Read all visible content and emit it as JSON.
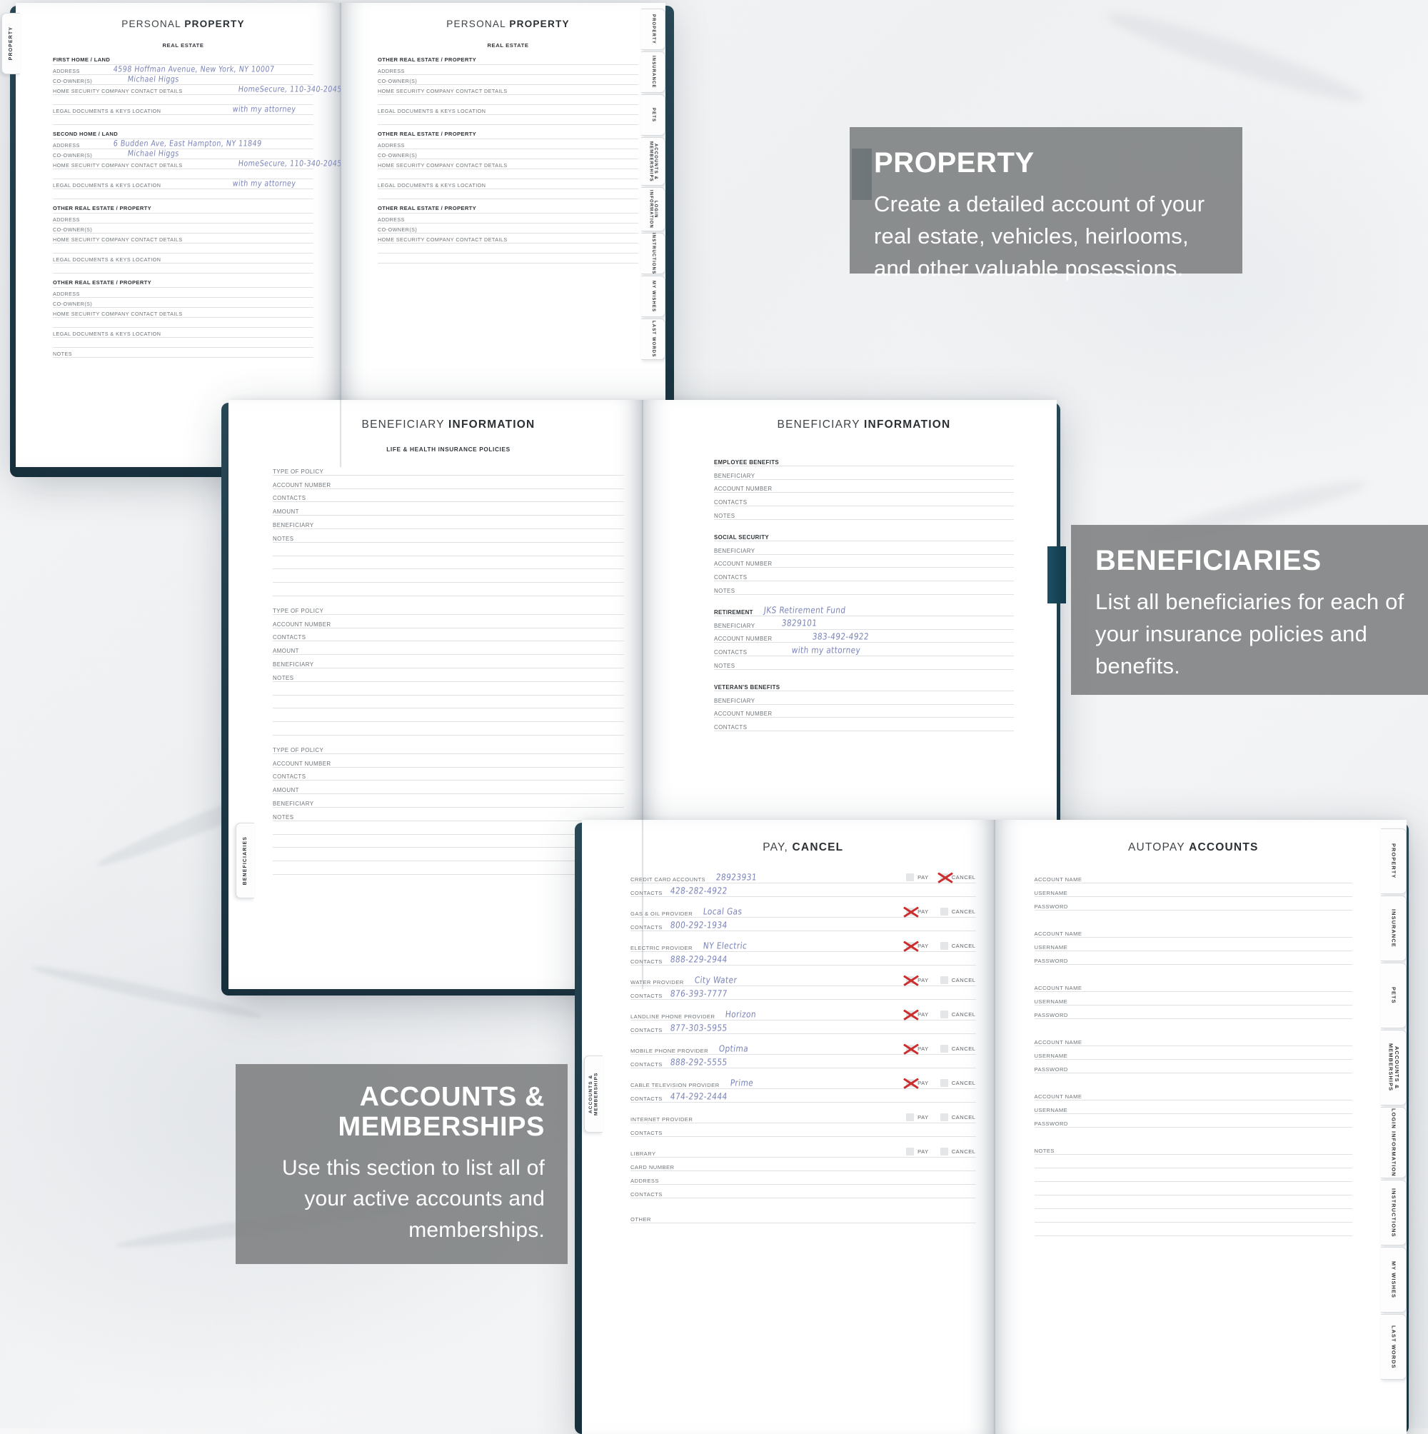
{
  "theme": {
    "accent": "#1e3c4a",
    "caption_bg": "rgba(124,126,128,0.88)",
    "handwriting": "#7b84b8",
    "x_mark": "#cc2f2f"
  },
  "captions": [
    {
      "title": "PROPERTY",
      "text": "Create a detailed account of your real estate, vehicles, heirlooms, and other valuable posessions."
    },
    {
      "title": "BENEFICIARIES",
      "text": "List all beneficiaries for each of your insurance policies and benefits."
    },
    {
      "title": "ACCOUNTS & MEMBERSHIPS",
      "text": "Use this section to list all of your active accounts and memberships."
    }
  ],
  "index_tabs": [
    "PROPERTY",
    "INSURANCE",
    "PETS",
    "ACCOUNTS & MEMBERSHIPS",
    "LOGIN INFORMATION",
    "INSTRUCTIONS",
    "MY WISHES",
    "LAST WORDS"
  ],
  "left_tabs": {
    "book1": "PROPERTY",
    "book2": "BENEFICIARIES",
    "book3": "ACCOUNTS & MEMBERSHIPS"
  },
  "book1": {
    "left_page": {
      "title_light": "PERSONAL ",
      "title_bold": "PROPERTY",
      "section": "REAL ESTATE",
      "groups": [
        {
          "heading": "FIRST HOME / LAND",
          "fields": [
            {
              "label": "ADDRESS",
              "value": "4598 Hoffman Avenue, New York, NY 10007",
              "indent": 74
            },
            {
              "label": "CO-OWNER(S)",
              "value": "Michael Higgs",
              "indent": 92
            },
            {
              "label": "HOME SECURITY COMPANY CONTACT DETAILS",
              "value": "HomeSecure, 110-340-2045",
              "indent": 224
            },
            {
              "label": "",
              "value": ""
            },
            {
              "label": "LEGAL DOCUMENTS & KEYS LOCATION",
              "value": "with my attorney",
              "indent": 222
            },
            {
              "label": "",
              "value": ""
            }
          ]
        },
        {
          "heading": "SECOND HOME / LAND",
          "fields": [
            {
              "label": "ADDRESS",
              "value": "6 Budden Ave, East  Hampton, NY 11849",
              "indent": 74
            },
            {
              "label": "CO-OWNER(S)",
              "value": "Michael Higgs",
              "indent": 92
            },
            {
              "label": "HOME SECURITY COMPANY CONTACT DETAILS",
              "value": "HomeSecure, 110-340-2045",
              "indent": 224
            },
            {
              "label": "",
              "value": ""
            },
            {
              "label": "LEGAL DOCUMENTS & KEYS LOCATION",
              "value": "with my attorney",
              "indent": 222
            },
            {
              "label": "",
              "value": ""
            }
          ]
        },
        {
          "heading": "OTHER REAL ESTATE / PROPERTY",
          "fields": [
            {
              "label": "ADDRESS",
              "value": ""
            },
            {
              "label": "CO-OWNER(S)",
              "value": ""
            },
            {
              "label": "HOME SECURITY COMPANY CONTACT DETAILS",
              "value": ""
            },
            {
              "label": "",
              "value": ""
            },
            {
              "label": "LEGAL DOCUMENTS & KEYS LOCATION",
              "value": ""
            },
            {
              "label": "",
              "value": ""
            }
          ]
        },
        {
          "heading": "OTHER REAL ESTATE / PROPERTY",
          "fields": [
            {
              "label": "ADDRESS",
              "value": ""
            },
            {
              "label": "CO-OWNER(S)",
              "value": ""
            },
            {
              "label": "HOME SECURITY COMPANY CONTACT DETAILS",
              "value": ""
            },
            {
              "label": "",
              "value": ""
            },
            {
              "label": "LEGAL DOCUMENTS & KEYS LOCATION",
              "value": ""
            },
            {
              "label": "",
              "value": ""
            },
            {
              "label": "NOTES",
              "value": ""
            }
          ]
        }
      ]
    },
    "right_page": {
      "title_light": "PERSONAL ",
      "title_bold": "PROPERTY",
      "section": "REAL ESTATE",
      "groups": [
        {
          "heading": "OTHER REAL ESTATE / PROPERTY",
          "fields": [
            {
              "label": "ADDRESS",
              "value": ""
            },
            {
              "label": "CO-OWNER(S)",
              "value": ""
            },
            {
              "label": "HOME SECURITY COMPANY CONTACT DETAILS",
              "value": ""
            },
            {
              "label": "",
              "value": ""
            },
            {
              "label": "LEGAL DOCUMENTS & KEYS LOCATION",
              "value": ""
            },
            {
              "label": "",
              "value": ""
            }
          ]
        },
        {
          "heading": "OTHER REAL ESTATE / PROPERTY",
          "fields": [
            {
              "label": "ADDRESS",
              "value": ""
            },
            {
              "label": "CO-OWNER(S)",
              "value": ""
            },
            {
              "label": "HOME SECURITY COMPANY CONTACT DETAILS",
              "value": ""
            },
            {
              "label": "",
              "value": ""
            },
            {
              "label": "LEGAL DOCUMENTS & KEYS LOCATION",
              "value": ""
            },
            {
              "label": "",
              "value": ""
            }
          ]
        },
        {
          "heading": "OTHER REAL ESTATE / PROPERTY",
          "fields": [
            {
              "label": "ADDRESS",
              "value": ""
            },
            {
              "label": "CO-OWNER(S)",
              "value": ""
            },
            {
              "label": "HOME SECURITY COMPANY CONTACT DETAILS",
              "value": ""
            },
            {
              "label": "",
              "value": ""
            },
            {
              "label": "",
              "value": ""
            }
          ]
        }
      ]
    }
  },
  "book2": {
    "left_page": {
      "title_light": "BENEFICIARY ",
      "title_bold": "INFORMATION",
      "section": "LIFE & HEALTH INSURANCE POLICIES",
      "blocks": [
        {
          "rows": [
            "TYPE OF POLICY",
            "ACCOUNT NUMBER",
            "CONTACTS",
            "AMOUNT",
            "BENEFICIARY",
            "NOTES"
          ],
          "extra": 4
        },
        {
          "rows": [
            "TYPE OF POLICY",
            "ACCOUNT NUMBER",
            "CONTACTS",
            "AMOUNT",
            "BENEFICIARY",
            "NOTES"
          ],
          "extra": 4
        },
        {
          "rows": [
            "TYPE OF POLICY",
            "ACCOUNT NUMBER",
            "CONTACTS",
            "AMOUNT",
            "BENEFICIARY",
            "NOTES"
          ],
          "extra": 4
        }
      ]
    },
    "right_page": {
      "title_light": "BENEFICIARY ",
      "title_bold": "INFORMATION",
      "groups": [
        {
          "heading": "EMPLOYEE BENEFITS",
          "heading_value": "",
          "fields": [
            {
              "label": "BENEFICIARY",
              "value": ""
            },
            {
              "label": "ACCOUNT NUMBER",
              "value": ""
            },
            {
              "label": "CONTACTS",
              "value": ""
            },
            {
              "label": "NOTES",
              "value": ""
            }
          ]
        },
        {
          "heading": "SOCIAL SECURITY",
          "heading_value": "",
          "fields": [
            {
              "label": "BENEFICIARY",
              "value": ""
            },
            {
              "label": "ACCOUNT NUMBER",
              "value": ""
            },
            {
              "label": "CONTACTS",
              "value": ""
            },
            {
              "label": "NOTES",
              "value": ""
            }
          ]
        },
        {
          "heading": "RETIREMENT",
          "heading_value": "JKS Retirement Fund",
          "fields": [
            {
              "label": "BENEFICIARY",
              "value": "3829101",
              "indent": 84
            },
            {
              "label": "ACCOUNT NUMBER",
              "value": "383-492-4922",
              "indent": 116
            },
            {
              "label": "CONTACTS",
              "value": "with my attorney",
              "indent": 96
            },
            {
              "label": "NOTES",
              "value": ""
            }
          ]
        },
        {
          "heading": "VETERAN'S BENEFITS",
          "heading_value": "",
          "fields": [
            {
              "label": "BENEFICIARY",
              "value": ""
            },
            {
              "label": "ACCOUNT NUMBER",
              "value": ""
            },
            {
              "label": "CONTACTS",
              "value": ""
            }
          ]
        }
      ]
    }
  },
  "book3": {
    "left_page": {
      "title_light": "PAY, ",
      "title_bold": "CANCEL",
      "pay_label": "PAY",
      "cancel_label": "CANCEL",
      "rows": [
        {
          "label": "CREDIT CARD ACCOUNTS",
          "value": "28923931",
          "contacts_label": "CONTACTS",
          "contacts": "428-282-4922",
          "pay": false,
          "cancel": true
        },
        {
          "label": "GAS & OIL PROVIDER",
          "value": "Local Gas",
          "contacts_label": "CONTACTS",
          "contacts": "800-292-1934",
          "pay": true,
          "cancel": false
        },
        {
          "label": "ELECTRIC PROVIDER",
          "value": "NY Electric",
          "contacts_label": "CONTACTS",
          "contacts": "888-229-2944",
          "pay": true,
          "cancel": false
        },
        {
          "label": "WATER PROVIDER",
          "value": "City Water",
          "contacts_label": "CONTACTS",
          "contacts": "876-393-7777",
          "pay": true,
          "cancel": false
        },
        {
          "label": "LANDLINE PHONE PROVIDER",
          "value": "Horizon",
          "contacts_label": "CONTACTS",
          "contacts": "877-303-5955",
          "pay": true,
          "cancel": false
        },
        {
          "label": "MOBILE PHONE PROVIDER",
          "value": "Optima",
          "contacts_label": "CONTACTS",
          "contacts": "888-292-5555",
          "pay": true,
          "cancel": false
        },
        {
          "label": "CABLE TELEVISION PROVIDER",
          "value": "Prime",
          "contacts_label": "CONTACTS",
          "contacts": "474-292-2444",
          "pay": true,
          "cancel": false
        },
        {
          "label": "INTERNET PROVIDER",
          "value": "",
          "contacts_label": "CONTACTS",
          "contacts": "",
          "pay": false,
          "cancel": false
        }
      ],
      "library": {
        "label": "LIBRARY",
        "pay": false,
        "cancel": false,
        "fields": [
          "CARD NUMBER",
          "ADDRESS",
          "CONTACTS"
        ]
      },
      "other_label": "OTHER"
    },
    "right_page": {
      "title_light": "AUTOPAY ",
      "title_bold": "ACCOUNTS",
      "blocks": [
        [
          "ACCOUNT NAME",
          "USERNAME",
          "PASSWORD"
        ],
        [
          "ACCOUNT NAME",
          "USERNAME",
          "PASSWORD"
        ],
        [
          "ACCOUNT NAME",
          "USERNAME",
          "PASSWORD"
        ],
        [
          "ACCOUNT NAME",
          "USERNAME",
          "PASSWORD"
        ],
        [
          "ACCOUNT NAME",
          "USERNAME",
          "PASSWORD"
        ]
      ],
      "notes_label": "NOTES",
      "notes_lines": 6
    }
  }
}
